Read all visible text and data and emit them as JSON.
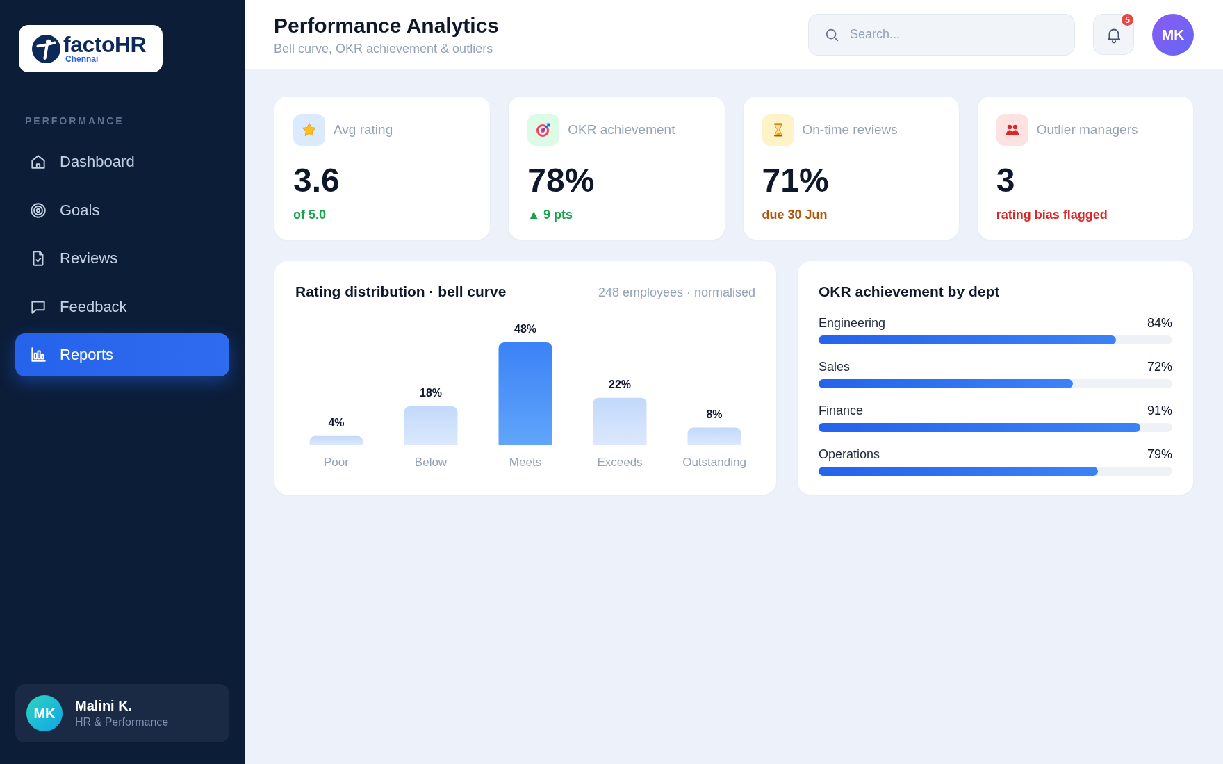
{
  "sidebar": {
    "logo": {
      "wordmark": "factoHR",
      "tagline": "Chennai"
    },
    "section_label": "PERFORMANCE",
    "items": [
      {
        "label": "Dashboard",
        "selected": false
      },
      {
        "label": "Goals",
        "selected": false
      },
      {
        "label": "Reviews",
        "selected": false
      },
      {
        "label": "Feedback",
        "selected": false
      },
      {
        "label": "Reports",
        "selected": true
      }
    ],
    "user": {
      "initials": "MK",
      "name": "Malini K.",
      "role": "HR & Performance"
    }
  },
  "header": {
    "title": "Performance Analytics",
    "subtitle": "Bell curve, OKR achievement & outliers",
    "search": {
      "placeholder": "Search..."
    },
    "notifications": {
      "count": "5"
    },
    "avatar": {
      "initials": "MK"
    }
  },
  "kpis": [
    {
      "label": "Avg rating",
      "value": "3.6",
      "note": "of 5.0",
      "color": "#16a34a"
    },
    {
      "label": "OKR achievement",
      "value": "78%",
      "note": "▲ 9 pts",
      "color": "#16a34a"
    },
    {
      "label": "On-time reviews",
      "value": "71%",
      "note": "due 30 Jun",
      "color": "#b45309"
    },
    {
      "label": "Outlier managers",
      "value": "3",
      "note": "rating bias flagged",
      "color": "#dc2626"
    }
  ],
  "rating_distribution": {
    "title": "Rating distribution · bell curve",
    "meta": "248 employees · normalised",
    "chart_data": {
      "type": "bar",
      "categories": [
        "Poor",
        "Below",
        "Meets",
        "Exceeds",
        "Outstanding"
      ],
      "values": [
        4,
        18,
        48,
        22,
        8
      ],
      "value_labels": [
        "4%",
        "18%",
        "48%",
        "22%",
        "8%"
      ]
    }
  },
  "okr_by_dept": {
    "title": "OKR achievement by dept",
    "rows": [
      {
        "name": "Engineering",
        "reading": "84%",
        "level": 0.84
      },
      {
        "name": "Sales",
        "reading": "72%",
        "level": 0.72
      },
      {
        "name": "Finance",
        "reading": "91%",
        "level": 0.91
      },
      {
        "name": "Operations",
        "reading": "79%",
        "level": 0.79
      }
    ]
  }
}
